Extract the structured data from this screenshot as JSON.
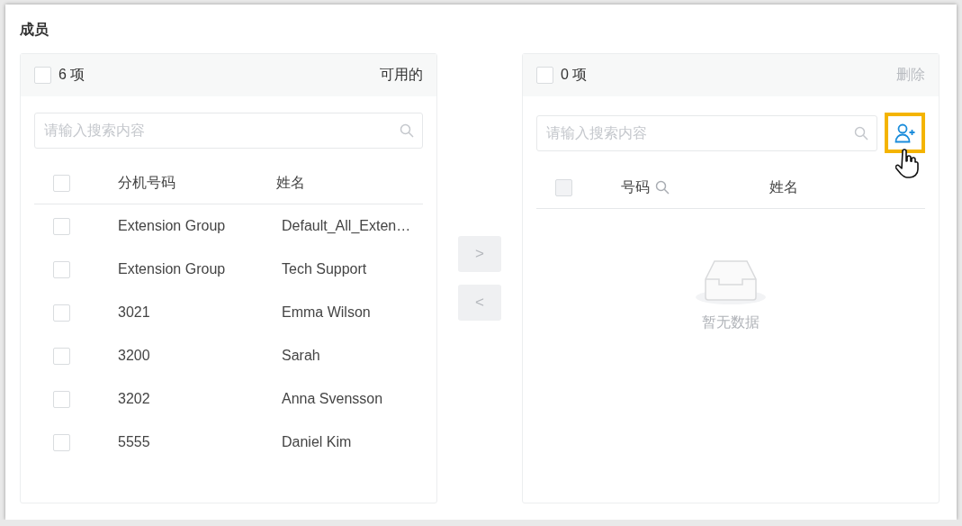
{
  "section_title": "成员",
  "source": {
    "count": "6 项",
    "checked": false,
    "title": "可用的",
    "search_placeholder": "请输入搜索内容",
    "select_all_disabled": false,
    "columns": [
      {
        "label": "分机号码",
        "searchable": false
      },
      {
        "label": "姓名",
        "searchable": false
      }
    ],
    "rows": [
      {
        "cells": [
          "Extension Group",
          "Default_All_Exten…"
        ],
        "checked": false
      },
      {
        "cells": [
          "Extension Group",
          "Tech Support"
        ],
        "checked": false
      },
      {
        "cells": [
          "3021",
          "Emma Wilson"
        ],
        "checked": false
      },
      {
        "cells": [
          "3200",
          "Sarah"
        ],
        "checked": false
      },
      {
        "cells": [
          "3202",
          "Anna Svensson"
        ],
        "checked": false
      },
      {
        "cells": [
          "5555",
          "Daniel Kim"
        ],
        "checked": false
      }
    ]
  },
  "transfer_buttons": [
    {
      "label": ">",
      "disabled": true
    },
    {
      "label": "<",
      "disabled": true
    }
  ],
  "target": {
    "count": "0 项",
    "checked": false,
    "action": "删除",
    "action_disabled": true,
    "search_placeholder": "请输入搜索内容",
    "add_button_highlighted": true,
    "select_all_disabled": true,
    "columns": [
      {
        "label": "号码",
        "searchable": true
      },
      {
        "label": "姓名",
        "searchable": false
      }
    ],
    "empty_text": "暂无数据"
  }
}
